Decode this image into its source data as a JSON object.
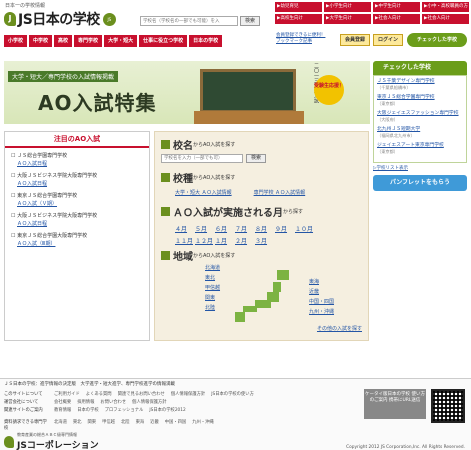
{
  "header": {
    "tagline": "日本一の学校情報",
    "logo_text": "JS日本の学校",
    "logo_badge": "JS",
    "search_placeholder": "学校名（学校名の一部でも可能）を入",
    "search_button": "検索",
    "quick_links": [
      "▶幼児育児",
      "▶小学生向け",
      "▶中学生向け",
      "▶小中・高校職員の方",
      "▶高校生向け",
      "▶大学生向け",
      "▶社会人向け",
      "▶社会人向け"
    ]
  },
  "nav": {
    "items": [
      "小学校",
      "中学校",
      "高校",
      "専門学校",
      "大学・短大",
      "仕事に役立つ学校",
      "日本の学校"
    ]
  },
  "member": {
    "line1": "会員登録できるに便利！",
    "line2": "ブックマーク記事",
    "register": "会員登録",
    "login": "ログイン",
    "checked": "チェックした学校"
  },
  "hero": {
    "subtitle": "大学・短大／専門学校の入試情報掲載",
    "title": "AO入試特集",
    "year": "二〇一三年度入試",
    "badge": "受験生応援！"
  },
  "featured": {
    "title": "注目のAO入試",
    "items": [
      {
        "school": "ＪＳ総合学園専門学校",
        "link": "ＡＯ入試日程"
      },
      {
        "school": "大阪ＪＳビジネス学院大阪専門学校",
        "link": "ＡＯ入試日程"
      },
      {
        "school": "東京ＪＳ総合学園専門学校",
        "link": "ＡＯ入試（Ｖ期）"
      },
      {
        "school": "大阪ＪＳビジネス学院大阪専門学校",
        "link": "ＡＯ入試日程"
      },
      {
        "school": "東京ＪＳ総合学園大阪専門学校",
        "link": "ＡＯ入試（Ⅲ期）"
      }
    ]
  },
  "center": {
    "name": {
      "big": "校名",
      "small": "からAO入試を探す",
      "placeholder": "学校名を入力（一部でも可）",
      "button": "検索"
    },
    "type": {
      "big": "校種",
      "small": "からAO入試を探す",
      "links": [
        "大学・短大 ＡＯ入試情報",
        "専門学校 ＡＯ入試情報"
      ]
    },
    "month": {
      "big": "ＡＯ入試が実施される月",
      "small": "から探す",
      "months": [
        "４月",
        "５月",
        "６月",
        "７月",
        "８月",
        "９月",
        "１０月",
        "１１月",
        "１２月",
        "１月",
        "２月",
        "３月"
      ]
    },
    "region": {
      "big": "地域",
      "small": "からAO入試を探す",
      "left": [
        "北海道",
        "東北",
        "甲信越",
        "関東",
        "北陸"
      ],
      "right": [
        "東海",
        "近畿",
        "中国・四国",
        "九州・沖縄"
      ]
    },
    "more": "その他の入試を探す"
  },
  "right": {
    "title": "チェックした学校",
    "items": [
      {
        "name": "ＪＳ千葉デザイン専門学校",
        "pref": "（千葉県船橋市）"
      },
      {
        "name": "東京ＪＳ総合学園専門学校",
        "pref": "（東京都）"
      },
      {
        "name": "大阪ジェイエスファッション専門学校",
        "pref": "（大阪府）"
      },
      {
        "name": "北九州ＪＳ短期大学",
        "pref": "（福岡県北九州市）"
      },
      {
        "name": "ジェイエスアート東京専門学校",
        "pref": "（東京都）"
      }
    ],
    "list_link": "▷学校リスト表示",
    "pamphlet": "パンフレットをもらう"
  },
  "footer": {
    "lead": "ＪＳ日本の学校：進学情報の決定版　大学進学・短大進学、専門学校進学の情報満載",
    "rows": [
      {
        "label": "このサイトについて",
        "links": [
          "ご利用ガイド",
          "よくある質問",
          "関連で見るお問い合わせ",
          "個人情報保護方針",
          "JS日本の学校の使い方"
        ]
      },
      {
        "label": "運営会社について",
        "links": [
          "会社概要",
          "採用情報",
          "お問い合わせ",
          "個人情報保護方針"
        ]
      },
      {
        "label": "関連サイトのご案内",
        "links": [
          "教育情報",
          "日本の学校",
          "プロフェッショナル",
          "JS日本の学校2012"
        ]
      },
      {
        "label": "資料請求できる専門学校",
        "links": [
          "北海道",
          "東北",
          "関東",
          "甲信越",
          "北陸",
          "東海",
          "近畿",
          "中国・四国",
          "九州・沖縄"
        ]
      }
    ],
    "box": "ケータイ版日本の学校 使い方のご案内 携帯にURL送信",
    "corp_sub": "教育産業の総合ＡＢＣ級専門情報",
    "corp_name": "JSコーポレーション",
    "copyright": "Copyright 2012 JS Corporation,Inc. All Rights Reserved."
  }
}
